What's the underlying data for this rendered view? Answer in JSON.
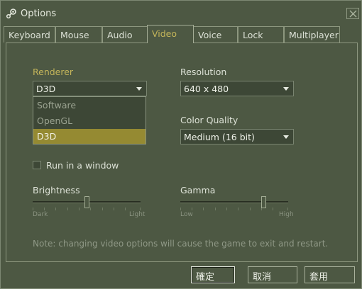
{
  "window": {
    "title": "Options"
  },
  "tabs": [
    "Keyboard",
    "Mouse",
    "Audio",
    "Video",
    "Voice",
    "Lock",
    "Multiplayer"
  ],
  "active_tab": "Video",
  "renderer": {
    "label": "Renderer",
    "value": "D3D",
    "options": [
      "Software",
      "OpenGL",
      "D3D"
    ],
    "selected": "D3D"
  },
  "resolution": {
    "label": "Resolution",
    "value": "640 x 480"
  },
  "color_quality": {
    "label": "Color Quality",
    "value": "Medium (16 bit)"
  },
  "run_in_window": {
    "label": "Run in a window",
    "checked": false
  },
  "brightness": {
    "label": "Brightness",
    "min_label": "Dark",
    "max_label": "Light",
    "level": 0.5
  },
  "gamma": {
    "label": "Gamma",
    "min_label": "Low",
    "max_label": "High",
    "level": 0.77
  },
  "note": "Note: changing video options will cause the game to exit and restart.",
  "buttons": {
    "ok": "確定",
    "cancel": "取消",
    "apply": "套用"
  },
  "colors": {
    "accent": "#c4b55a",
    "selection": "#958a32",
    "background": "#4d5843"
  }
}
